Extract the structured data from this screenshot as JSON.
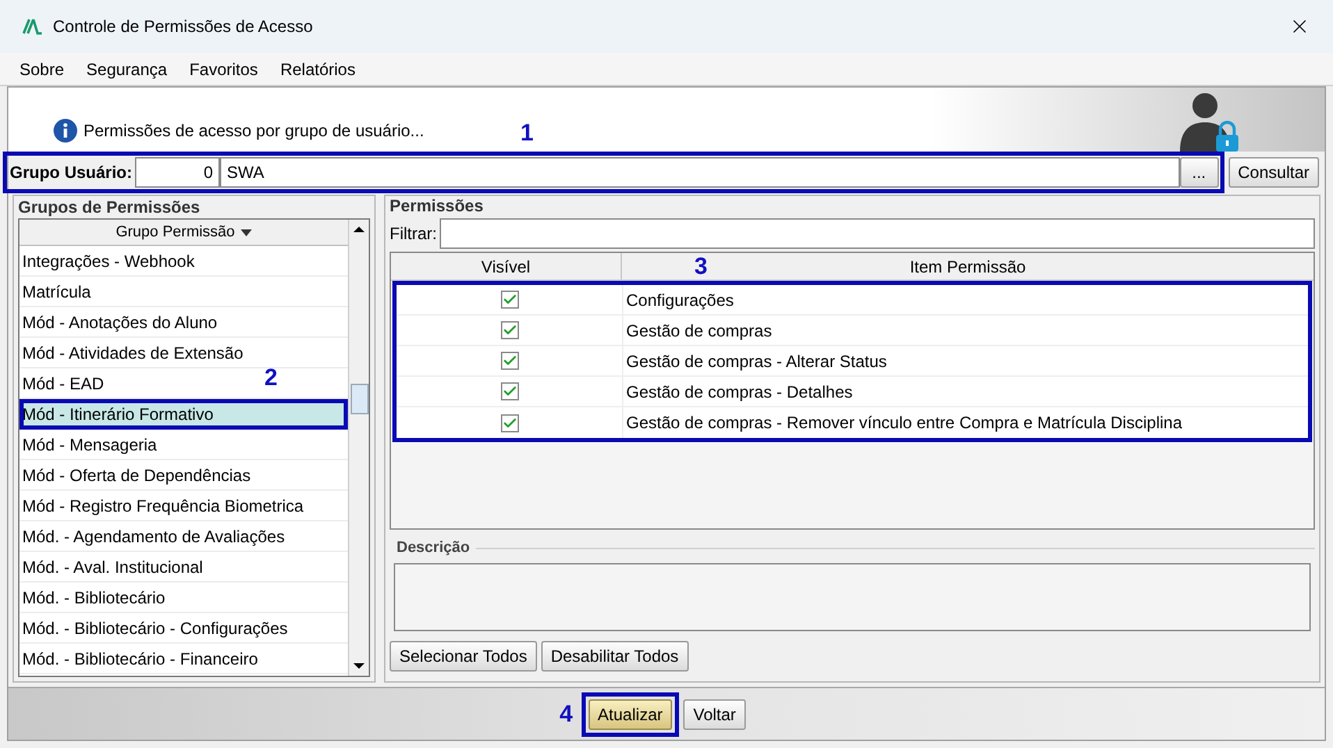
{
  "window": {
    "title": "Controle de Permissões de Acesso"
  },
  "menu": [
    "Sobre",
    "Segurança",
    "Favoritos",
    "Relatórios"
  ],
  "header": {
    "info": "Permissões de acesso por grupo de usuário..."
  },
  "user_group": {
    "label": "Grupo Usuário:",
    "code": "0",
    "name": "SWA",
    "browse": "...",
    "search_button": "Consultar",
    "annotation": "1"
  },
  "groups_panel": {
    "title": "Grupos de Permissões",
    "column": "Grupo Permissão",
    "annotation": "2",
    "items": [
      {
        "label": "Integrações - Webhook",
        "selected": false
      },
      {
        "label": "Matrícula",
        "selected": false
      },
      {
        "label": "Mód - Anotações do Aluno",
        "selected": false
      },
      {
        "label": "Mód - Atividades de Extensão",
        "selected": false
      },
      {
        "label": "Mód - EAD",
        "selected": false
      },
      {
        "label": "Mód - Itinerário Formativo",
        "selected": true
      },
      {
        "label": "Mód - Mensageria",
        "selected": false
      },
      {
        "label": "Mód - Oferta de Dependências",
        "selected": false
      },
      {
        "label": "Mód - Registro Frequência Biometrica",
        "selected": false
      },
      {
        "label": "Mód. - Agendamento de Avaliações",
        "selected": false
      },
      {
        "label": "Mód. - Aval. Institucional",
        "selected": false
      },
      {
        "label": "Mód. - Bibliotecário",
        "selected": false
      },
      {
        "label": "Mód. - Bibliotecário - Configurações",
        "selected": false
      },
      {
        "label": "Mód. - Bibliotecário - Financeiro",
        "selected": false
      }
    ]
  },
  "permissions": {
    "title": "Permissões",
    "filter_label": "Filtrar:",
    "columns": [
      "Visível",
      "Item Permissão"
    ],
    "annotation": "3",
    "rows": [
      {
        "visible": true,
        "item": "Configurações"
      },
      {
        "visible": true,
        "item": "Gestão de compras"
      },
      {
        "visible": true,
        "item": "Gestão de compras - Alterar Status"
      },
      {
        "visible": true,
        "item": "Gestão de compras - Detalhes"
      },
      {
        "visible": true,
        "item": "Gestão de compras - Remover vínculo entre Compra e Matrícula Disciplina"
      }
    ]
  },
  "description": {
    "title": "Descrição"
  },
  "bulk_buttons": [
    "Selecionar Todos",
    "Desabilitar Todos"
  ],
  "footer": {
    "annotation": "4",
    "buttons": [
      {
        "label": "Atualizar",
        "highlighted": true
      },
      {
        "label": "Voltar",
        "highlighted": false
      }
    ]
  }
}
